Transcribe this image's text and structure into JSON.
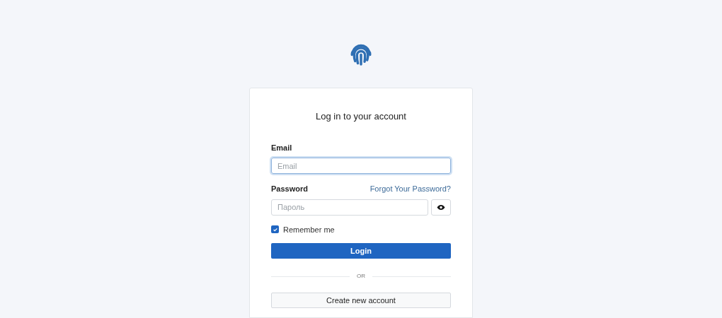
{
  "title": "Log in to your account",
  "email": {
    "label": "Email",
    "placeholder": "Email",
    "focused": true
  },
  "password": {
    "label": "Password",
    "placeholder": "Пароль",
    "forgot_link": "Forgot Your Password?"
  },
  "remember": {
    "label": "Remember me",
    "checked": true
  },
  "login_button": "Login",
  "divider_text": "OR",
  "create_button": "Create new account"
}
